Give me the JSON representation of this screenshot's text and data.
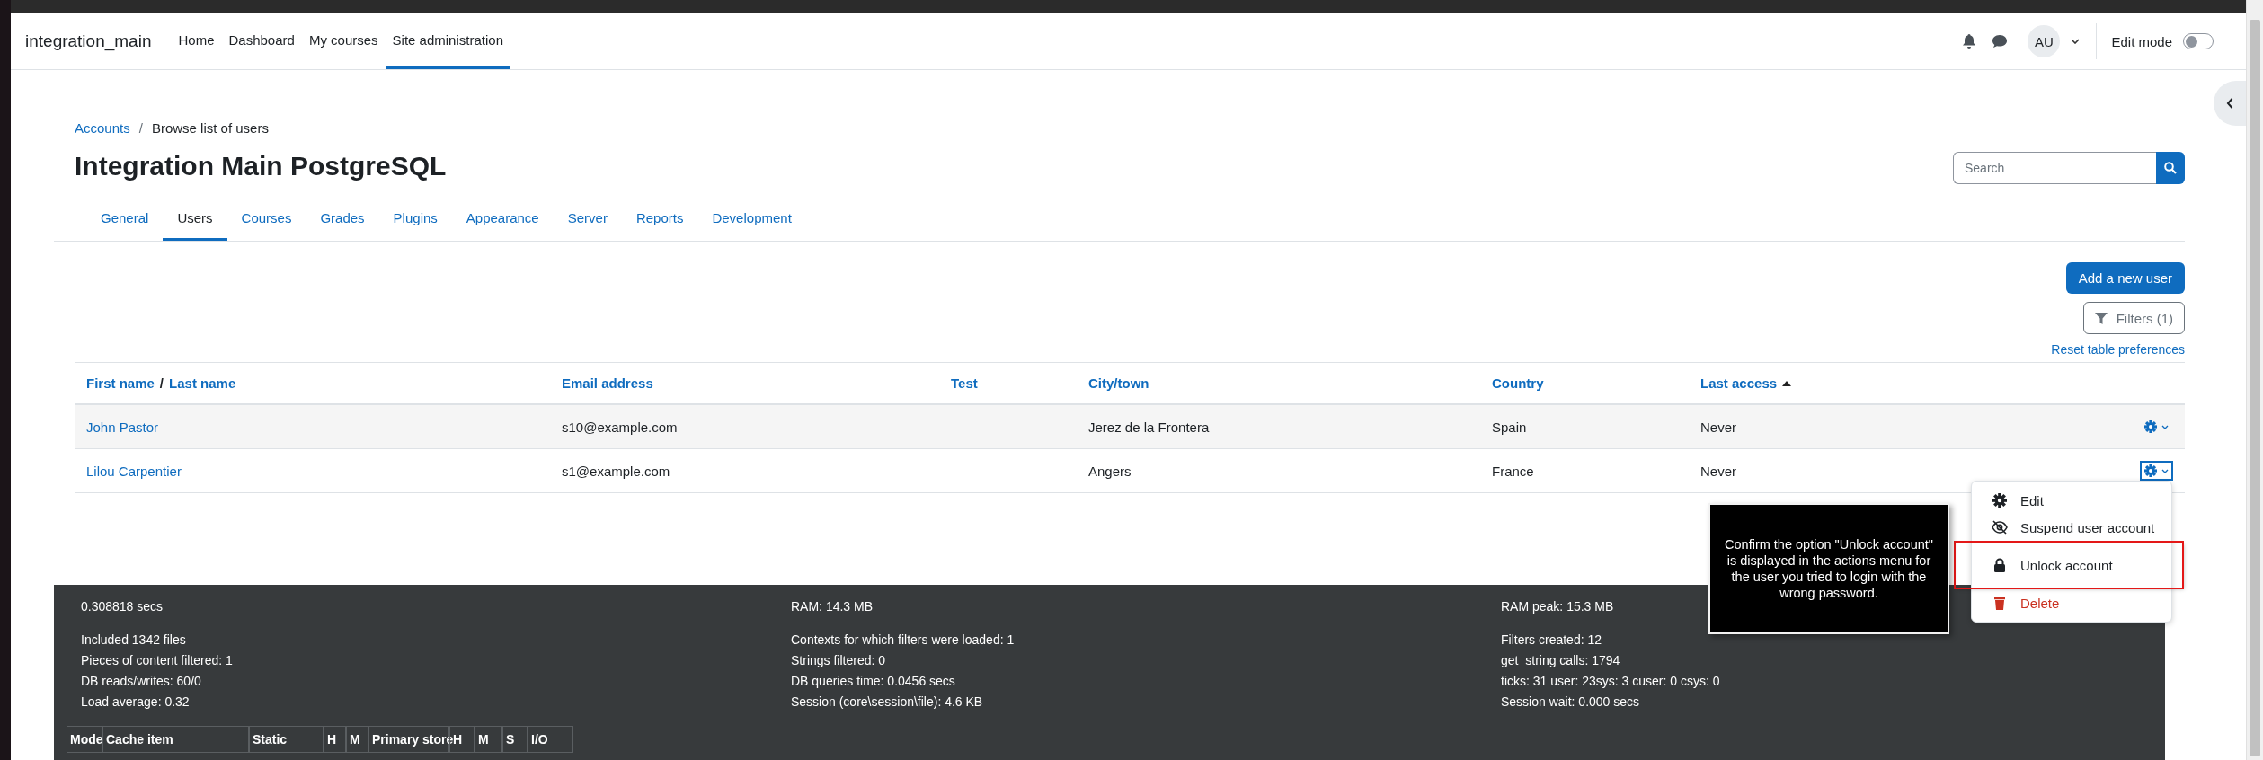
{
  "navbar": {
    "brand": "integration_main",
    "items": [
      {
        "label": "Home",
        "selected": false
      },
      {
        "label": "Dashboard",
        "selected": false
      },
      {
        "label": "My courses",
        "selected": false
      },
      {
        "label": "Site administration",
        "selected": true
      }
    ],
    "avatar": "AU",
    "edit_mode": {
      "label": "Edit mode",
      "on": false
    }
  },
  "breadcrumb": [
    {
      "label": "Accounts",
      "link": true
    },
    {
      "label": "Browse list of users",
      "link": false
    }
  ],
  "breadcrumb_separator": "/",
  "title": "Integration Main PostgreSQL",
  "search": {
    "placeholder": "Search"
  },
  "tabs": [
    {
      "label": "General",
      "selected": false
    },
    {
      "label": "Users",
      "selected": true
    },
    {
      "label": "Courses",
      "selected": false
    },
    {
      "label": "Grades",
      "selected": false
    },
    {
      "label": "Plugins",
      "selected": false
    },
    {
      "label": "Appearance",
      "selected": false
    },
    {
      "label": "Server",
      "selected": false
    },
    {
      "label": "Reports",
      "selected": false
    },
    {
      "label": "Development",
      "selected": false
    }
  ],
  "add_button": "Add a new user",
  "filters_button": "Filters (1)",
  "reset_link": "Reset table preferences",
  "table": {
    "columns": [
      {
        "labels": [
          "First name",
          "Last name"
        ],
        "separator": "/",
        "sorted": false
      },
      {
        "labels": [
          "Email address"
        ],
        "sorted": false
      },
      {
        "labels": [
          "Test"
        ],
        "sorted": false
      },
      {
        "labels": [
          "City/town"
        ],
        "sorted": false
      },
      {
        "labels": [
          "Country"
        ],
        "sorted": false
      },
      {
        "labels": [
          "Last access"
        ],
        "sorted": true
      }
    ],
    "rows": [
      {
        "cells": [
          "John Pastor",
          "s10@example.com",
          "",
          "Jerez de la Frontera",
          "Spain",
          "Never"
        ],
        "actions_focused": false
      },
      {
        "cells": [
          "Lilou Carpentier",
          "s1@example.com",
          "",
          "Angers",
          "France",
          "Never"
        ],
        "actions_focused": true
      }
    ]
  },
  "actions_menu": {
    "items": [
      {
        "kind": "edit",
        "label": "Edit",
        "highlighted": false
      },
      {
        "kind": "suspend",
        "label": "Suspend user account",
        "highlighted": false
      },
      {
        "kind": "unlock",
        "label": "Unlock account",
        "highlighted": true
      },
      {
        "kind": "delete",
        "label": "Delete",
        "highlighted": false
      }
    ]
  },
  "callout": "Confirm the option \"Unlock account\" is displayed in the actions menu for the user you tried to login with the wrong password.",
  "footer": {
    "columns": [
      {
        "head": "0.308818 secs",
        "lines": [
          "Included 1342 files",
          "Pieces of content filtered: 1",
          "DB reads/writes: 60/0",
          "Load average: 0.32"
        ]
      },
      {
        "head": "RAM: 14.3 MB",
        "lines": [
          "Contexts for which filters were loaded: 1",
          "Strings filtered: 0",
          "DB queries time: 0.0456 secs",
          "Session (core\\session\\file): 4.6 KB"
        ]
      },
      {
        "head": "RAM peak: 15.3 MB",
        "lines": [
          "Filters created: 12",
          "get_string calls: 1794",
          "ticks: 31 user: 23sys: 3 cuser: 0 csys: 0",
          "Session wait: 0.000 secs"
        ]
      }
    ],
    "cache_headers": [
      "Mode",
      "Cache item",
      "Static",
      "H",
      "M",
      "Primary store",
      "H",
      "M",
      "S",
      "I/O"
    ]
  }
}
